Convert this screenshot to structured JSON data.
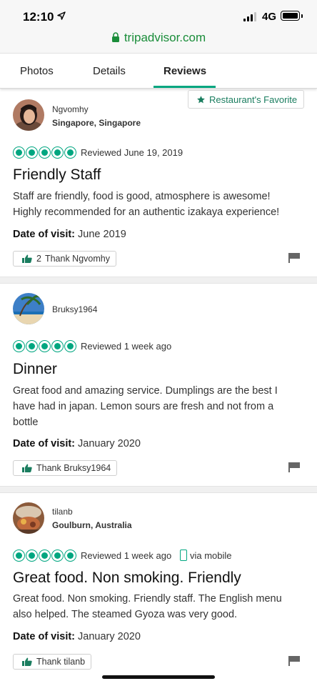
{
  "status_bar": {
    "time": "12:10",
    "network": "4G",
    "location_icon": "location-arrow-icon",
    "battery_icon": "battery-icon"
  },
  "browser": {
    "url": "tripadvisor.com",
    "lock_icon": "lock-icon"
  },
  "tabs": [
    {
      "label": "Photos",
      "active": false
    },
    {
      "label": "Details",
      "active": false
    },
    {
      "label": "Reviews",
      "active": true
    }
  ],
  "badge": {
    "label": "Restaurant's Favorite",
    "icon": "star-icon"
  },
  "reviews": [
    {
      "username": "Ngvomhy",
      "location": "Singapore, Singapore",
      "rating": 5,
      "reviewed": "Reviewed June 19, 2019",
      "title": "Friendly Staff",
      "body": "Staff are friendly, food is good, atmosphere is awesome! Highly recommended for an authentic izakaya experience!",
      "visit_label": "Date of visit:",
      "visit_date": "June 2019",
      "thank_count": "2",
      "thank_label": "Thank Ngvomhy"
    },
    {
      "username": "Bruksy1964",
      "rating": 5,
      "reviewed": "Reviewed 1 week ago",
      "title": "Dinner",
      "body": "Great food and amazing service. Dumplings are the best I have had in japan. Lemon sours are fresh and not from a bottle",
      "visit_label": "Date of visit:",
      "visit_date": "January 2020",
      "thank_label": "Thank Bruksy1964"
    },
    {
      "username": "tilanb",
      "location": "Goulburn, Australia",
      "rating": 5,
      "reviewed": "Reviewed 1 week ago",
      "via": "via mobile",
      "title": "Great food. Non smoking. Friendly",
      "body": "Great food. Non smoking. Friendly staff. The English menu also helped. The steamed Gyoza was very good.",
      "visit_label": "Date of visit:",
      "visit_date": "January 2020",
      "thank_label": "Thank tilanb"
    }
  ],
  "colors": {
    "brand_green": "#00a680",
    "url_green": "#1a8d3a",
    "badge_text": "#1a7d5f"
  }
}
